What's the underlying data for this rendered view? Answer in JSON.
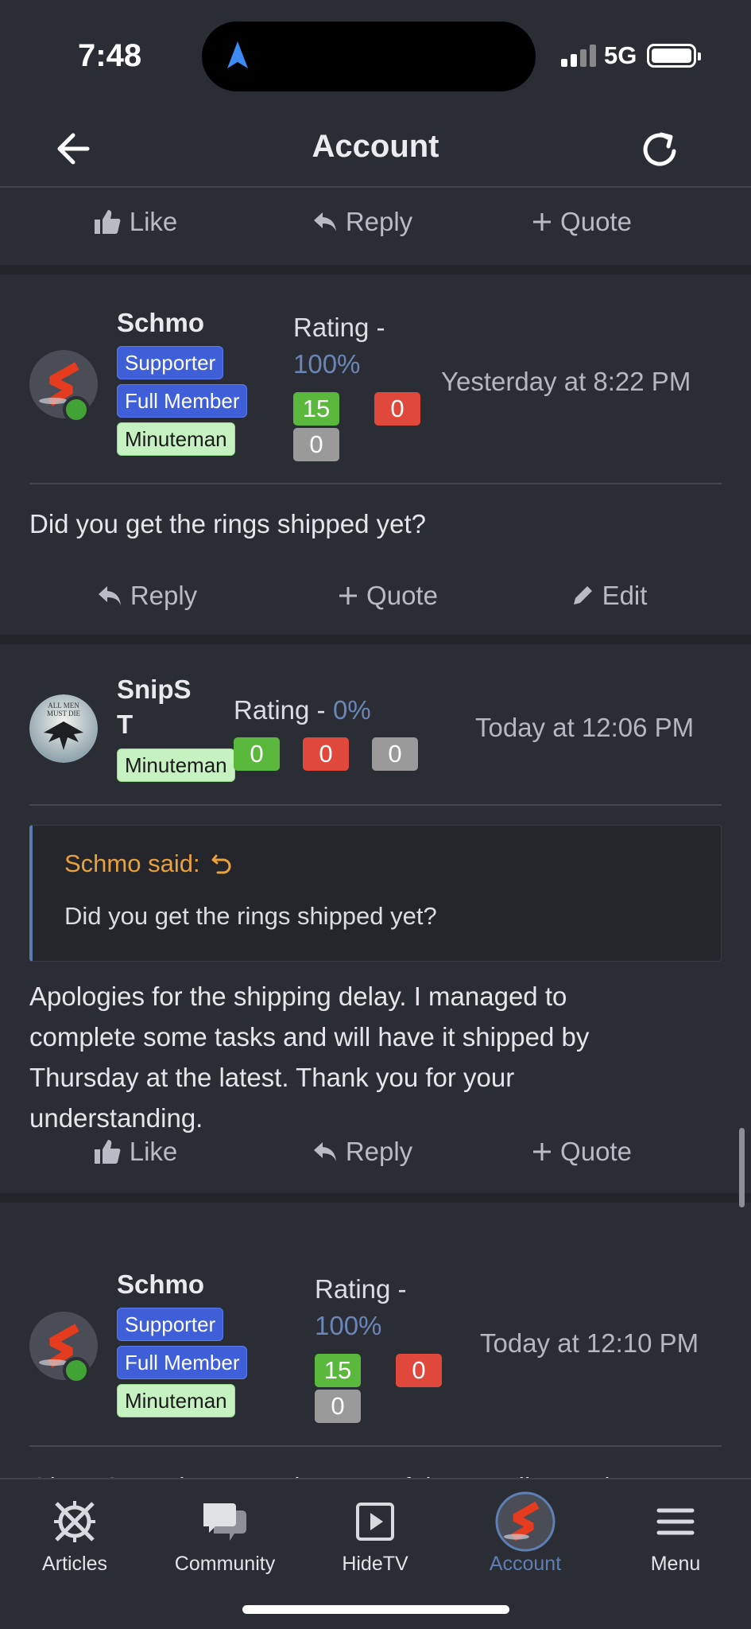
{
  "status_bar": {
    "time": "7:48",
    "network": "5G"
  },
  "header": {
    "title": "Account"
  },
  "top_actions": {
    "like": "Like",
    "reply": "Reply",
    "quote": "Quote"
  },
  "posts": [
    {
      "username": "Schmo",
      "badges": [
        "Supporter",
        "Full Member",
        "Minuteman"
      ],
      "rating_label": "Rating -",
      "rating_pct": "100%",
      "positive": "15",
      "negative": "0",
      "neutral": "0",
      "timestamp": "Yesterday at 8:22 PM",
      "body": "Did you get the rings shipped yet?",
      "actions": {
        "reply": "Reply",
        "quote": "Quote",
        "edit": "Edit"
      }
    },
    {
      "username_line1": "SnipS",
      "username_line2": "T",
      "badges": [
        "Minuteman"
      ],
      "rating_label": "Rating -",
      "rating_pct": "0%",
      "positive": "0",
      "negative": "0",
      "neutral": "0",
      "timestamp": "Today at 12:06 PM",
      "avatar_text": "ALL MEN MUST DIE",
      "quote": {
        "author": "Schmo said:",
        "text": "Did you get the rings shipped yet?"
      },
      "body_lines": [
        "Apologies for the shipping delay. I managed to",
        "complete some tasks and will have it shipped by",
        "Thursday at the latest. Thank you for your",
        "understanding."
      ],
      "actions": {
        "like": "Like",
        "reply": "Reply",
        "quote": "Quote"
      }
    },
    {
      "username": "Schmo",
      "badges": [
        "Supporter",
        "Full Member",
        "Minuteman"
      ],
      "rating_label": "Rating -",
      "rating_pct": "100%",
      "positive": "15",
      "negative": "0",
      "neutral": "0",
      "timestamp": "Today at 12:10 PM",
      "body_partial": "Okay. Some letters at the start of the next line... Th"
    }
  ],
  "tabs": [
    {
      "label": "Articles",
      "icon": "articles-icon"
    },
    {
      "label": "Community",
      "icon": "chat-bubbles-icon"
    },
    {
      "label": "HideTV",
      "icon": "play-icon"
    },
    {
      "label": "Account",
      "icon": "avatar",
      "active": true
    },
    {
      "label": "Menu",
      "icon": "hamburger-icon"
    }
  ],
  "colors": {
    "background": "#2b2d34",
    "accent_blue": "#5d7fb6",
    "badge_blue": "#3f5fd8",
    "badge_green": "#c6f1c0",
    "positive": "#5ab83c",
    "negative": "#e0483c",
    "neutral": "#9a9a9a",
    "quote_author": "#e9a13b"
  }
}
